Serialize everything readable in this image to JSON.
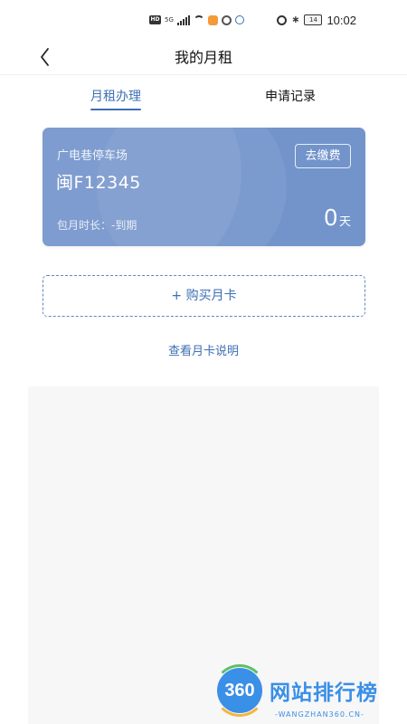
{
  "status_bar": {
    "hd": "HD",
    "signal_label": "5G",
    "battery": "14",
    "time": "10:02"
  },
  "nav": {
    "title": "我的月租"
  },
  "tabs": [
    {
      "label": "月租办理",
      "active": true
    },
    {
      "label": "申请记录",
      "active": false
    }
  ],
  "card": {
    "lot_name": "广电巷停车场",
    "plate": "闽F12345",
    "duration": "包月时长：-到期",
    "pay_button": "去缴费",
    "days_value": "0",
    "days_unit": "天",
    "background_color": "#7394cb"
  },
  "buy_button": {
    "label": "+ 购买月卡"
  },
  "view_description": {
    "label": "查看月卡说明"
  },
  "watermark": {
    "logo": "360",
    "text": "网站排行榜",
    "subtext": "-WANGZHAN360.CN-"
  },
  "colors": {
    "accent": "#3e6fb3",
    "card": "#7394cb",
    "lower_area": "#f7f7f8"
  }
}
